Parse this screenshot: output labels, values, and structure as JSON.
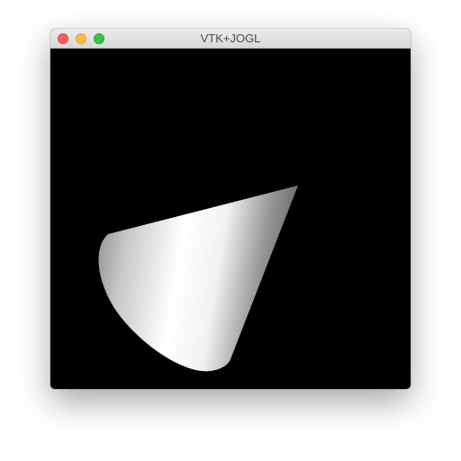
{
  "window": {
    "title": "VTK+JOGL",
    "buttons": {
      "close": "close-button",
      "minimize": "minimize-button",
      "zoom": "zoom-button"
    }
  },
  "viewport": {
    "background": "#000000",
    "object": "cone",
    "object_color": "#ffffff"
  }
}
